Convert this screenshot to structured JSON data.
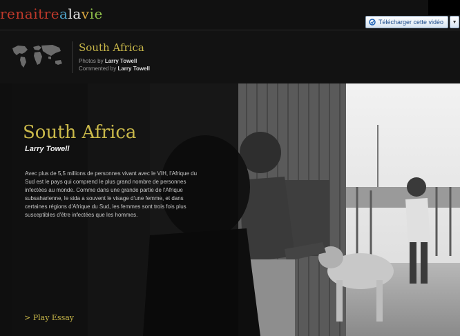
{
  "logo": {
    "part1": "renaitre",
    "part2": "a",
    "part3": "la",
    "part4": "v",
    "part5": "ie"
  },
  "toolbar": {
    "download_label": "Télécharger cette vidéo"
  },
  "header": {
    "country": "South Africa",
    "photos_prefix": "Photos by ",
    "photos_author": "Larry Towell",
    "commented_prefix": "Commented by ",
    "commented_author": "Larry Towell"
  },
  "feature": {
    "title": "South Africa",
    "author": "Larry Towell",
    "description": "Avec plus de 5,5 millions de personnes vivant avec le VIH, l'Afrique du Sud est le pays qui comprend le plus grand nombre de personnes infectées au monde. Comme dans une grande partie de l'Afrique subsaharienne, le sida a souvent le visage d'une femme, et dans certaines régions d'Afrique du Sud, les femmes sont trois fois plus susceptibles d'être infectées que les hommes.",
    "play_label": "> Play Essay"
  },
  "colors": {
    "accent": "#c9b84a",
    "background": "#0f0f0f",
    "download_text": "#1a4a8a"
  }
}
